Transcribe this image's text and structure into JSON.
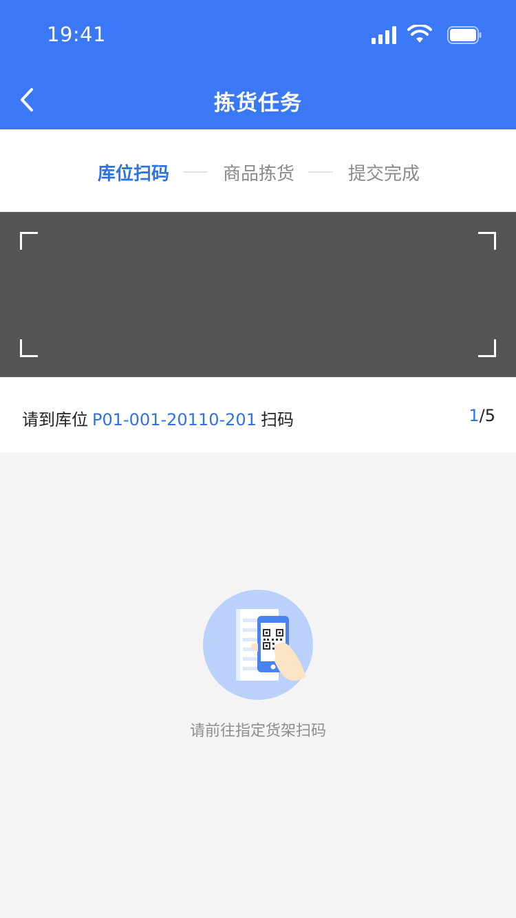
{
  "status_bar": {
    "time": "19:41",
    "icons": [
      "signal-icon",
      "wifi-icon",
      "battery-icon"
    ]
  },
  "nav": {
    "title": "拣货任务",
    "back_icon": "chevron-left-icon"
  },
  "steps": [
    {
      "label": "库位扫码",
      "active": true
    },
    {
      "label": "商品拣货",
      "active": false
    },
    {
      "label": "提交完成",
      "active": false
    }
  ],
  "scanner": {
    "icons": [
      "corner-icon"
    ]
  },
  "location": {
    "prefix": "请到库位",
    "code": "P01-001-20110-201",
    "suffix": "扫码",
    "progress_current": "1",
    "progress_total": "/5"
  },
  "empty_state": {
    "icon": "scan-qr-illustration-icon",
    "message": "请前往指定货架扫码"
  },
  "colors": {
    "primary": "#3a78f5",
    "accent_text": "#2f73e0",
    "scanner_bg": "#555555",
    "page_bg": "#f4f4f4",
    "illustration_circle": "#b9d1fb"
  }
}
